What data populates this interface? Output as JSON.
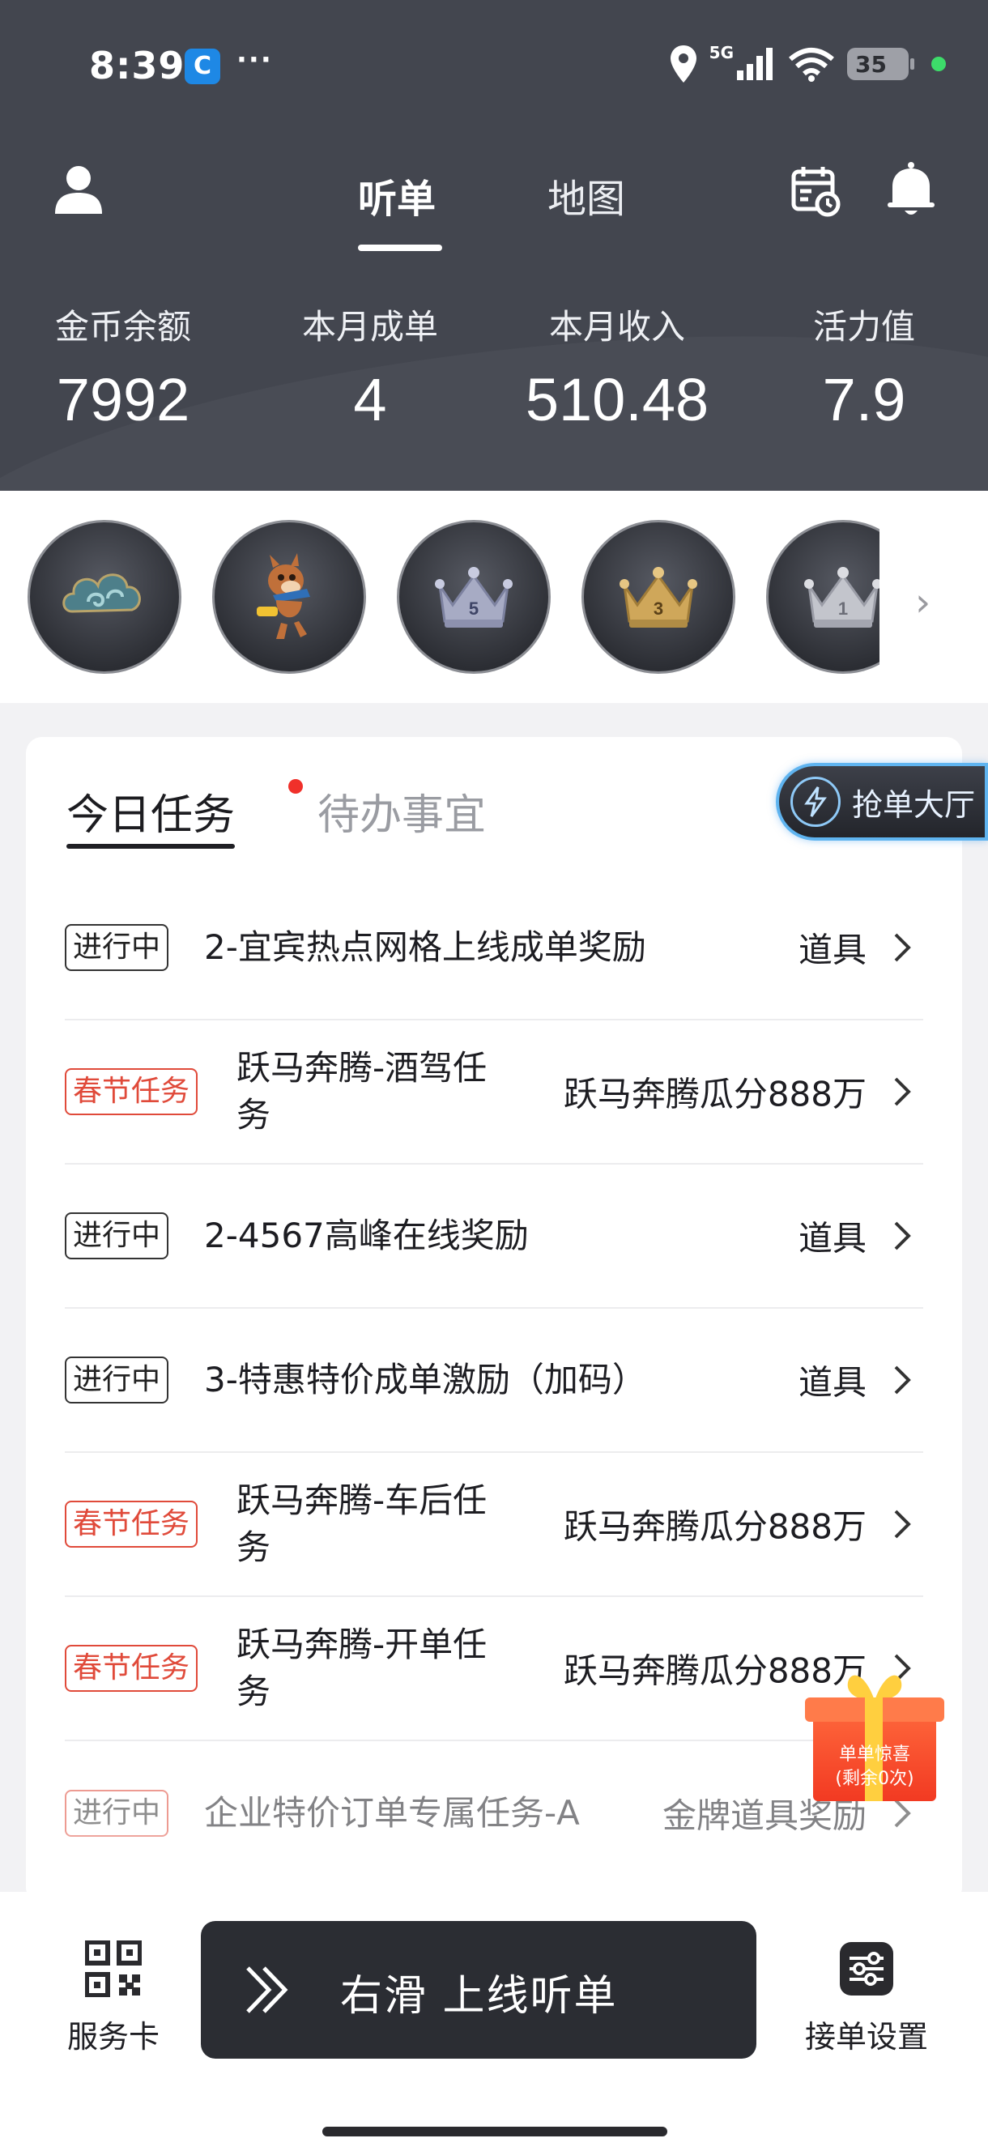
{
  "status_bar": {
    "time": "8:39",
    "app_badge": "C",
    "dots": "···",
    "network": "5G",
    "battery": "35"
  },
  "nav": {
    "tabs": [
      {
        "label": "听单",
        "active": true
      },
      {
        "label": "地图",
        "active": false
      }
    ],
    "icons": [
      "avatar-icon",
      "calendar-icon",
      "bell-icon"
    ]
  },
  "stats": [
    {
      "label": "金币余额",
      "value": "7992"
    },
    {
      "label": "本月成单",
      "value": "4"
    },
    {
      "label": "本月收入",
      "value": "510.48"
    },
    {
      "label": "活力值",
      "value": "7.9"
    }
  ],
  "badges": [
    {
      "icon": "cloud-badge-icon"
    },
    {
      "icon": "horse-mascot-badge-icon"
    },
    {
      "icon": "silver-crown-5-icon",
      "level": "5"
    },
    {
      "icon": "gold-crown-3-icon",
      "level": "3"
    },
    {
      "icon": "silver-crown-1-icon",
      "level": "1"
    }
  ],
  "task_card": {
    "tabs": [
      {
        "label": "今日任务",
        "active": true,
        "has_dot": true
      },
      {
        "label": "待办事宜",
        "active": false
      }
    ],
    "grab_hall_label": "抢单大厅",
    "tasks": [
      {
        "tag": "进行中",
        "tag_type": "going",
        "title": "2-宜宾热点网格上线成单奖励",
        "reward": "道具"
      },
      {
        "tag": "春节任务",
        "tag_type": "spring",
        "title": "跃马奔腾-酒驾任务",
        "reward": "跃马奔腾瓜分888万"
      },
      {
        "tag": "进行中",
        "tag_type": "going",
        "title": "2-4567高峰在线奖励",
        "reward": "道具"
      },
      {
        "tag": "进行中",
        "tag_type": "going",
        "title": "3-特惠特价成单激励（加码）",
        "reward": "道具"
      },
      {
        "tag": "春节任务",
        "tag_type": "spring",
        "title": "跃马奔腾-车后任务",
        "reward": "跃马奔腾瓜分888万"
      },
      {
        "tag": "春节任务",
        "tag_type": "spring",
        "title": "跃马奔腾-开单任务",
        "reward": "跃马奔腾瓜分888万"
      },
      {
        "tag": "进行中",
        "tag_type": "going",
        "title": "企业特价订单专属任务-A",
        "reward": "金牌道具奖励"
      }
    ]
  },
  "gift_popup": {
    "line1": "单单惊喜",
    "line2": "(剩余0次)"
  },
  "bottom_bar": {
    "service_card_label": "服务卡",
    "online_button_label": "右滑  上线听单",
    "order_settings_label": "接单设置"
  }
}
